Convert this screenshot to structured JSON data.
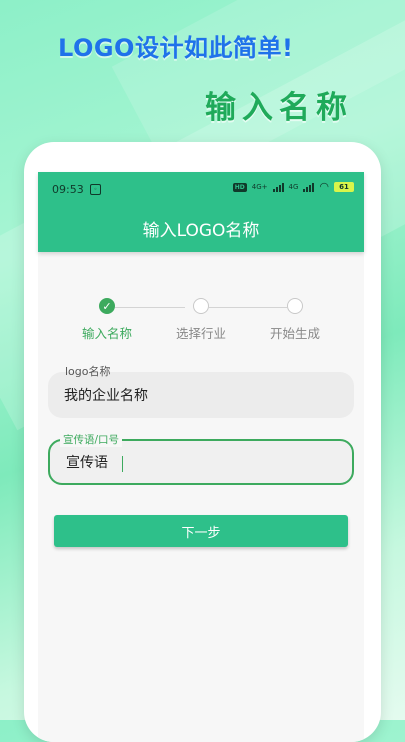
{
  "promo": {
    "headline": "LOGO设计如此简单!",
    "subheadline": "输入名称"
  },
  "status_bar": {
    "time": "09:53",
    "network_badge": "HD",
    "signal1": "4G+",
    "signal2": "4G",
    "battery": "61"
  },
  "app_bar": {
    "title": "输入LOGO名称"
  },
  "steps": [
    {
      "label": "输入名称",
      "state": "done"
    },
    {
      "label": "选择行业",
      "state": "todo"
    },
    {
      "label": "开始生成",
      "state": "todo"
    }
  ],
  "form": {
    "logo_name": {
      "label": "logo名称",
      "value": "我的企业名称"
    },
    "slogan": {
      "label": "宣传语/口号",
      "value": "宣传语"
    }
  },
  "next_button": "下一步",
  "colors": {
    "primary": "#2ec08a",
    "accent": "#3daa5e",
    "headline": "#1f72ea"
  }
}
